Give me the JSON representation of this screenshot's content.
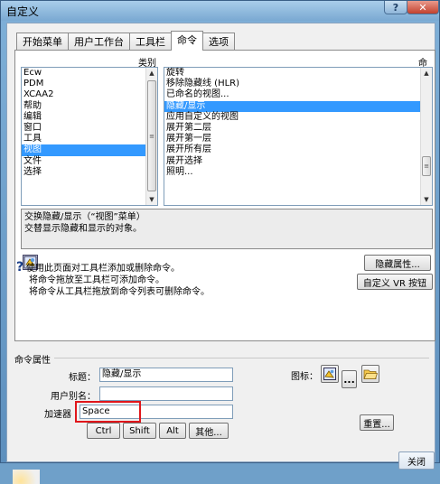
{
  "window": {
    "title": "自定义",
    "help_glyph": "?",
    "close_glyph": "✕"
  },
  "tabs": [
    {
      "label": "开始菜单"
    },
    {
      "label": "用户工作台"
    },
    {
      "label": "工具栏"
    },
    {
      "label": "命令",
      "active": true
    },
    {
      "label": "选项"
    }
  ],
  "category_header": "类别",
  "command_header": "命令",
  "categories": [
    "Ecw",
    "PDM",
    "XCAA2",
    "帮助",
    "编辑",
    "窗口",
    "工具",
    "视图",
    "文件",
    "选择"
  ],
  "selected_category": "视图",
  "commands": [
    "旋转",
    "移除隐藏线 (HLR)",
    "已命名的视图...",
    "隐藏/显示",
    "应用自定义的视图",
    "展开第二层",
    "展开第一层",
    "展开所有层",
    "展开选择",
    "照明..."
  ],
  "selected_command": "隐藏/显示",
  "description": {
    "line1": "交换隐藏/显示（“视图”菜单）",
    "line2": "交替显示隐藏和显示的对象。"
  },
  "buttons": {
    "hide_properties": "隐藏属性...",
    "custom_vr": "自定义 VR 按钮",
    "ctrl": "Ctrl",
    "shift": "Shift",
    "alt": "Alt",
    "other": "其他...",
    "reset": "重置...",
    "icon_more": "...",
    "close": "关闭"
  },
  "help": {
    "line1": "使用此页面对工具栏添加或删除命令。",
    "line2": "将命令拖放至工具栏可添加命令。",
    "line3": "将命令从工具栏拖放到命令列表可删除命令。"
  },
  "properties": {
    "group_label": "命令属性",
    "title_label": "标题：",
    "title_value": "隐藏/显示",
    "alias_label": "用户别名：",
    "alias_value": "",
    "accelerator_label": "加速器",
    "accelerator_value": "Space",
    "icon_label": "图标："
  },
  "colors": {
    "selection": "#3399ff",
    "highlight_box": "#e0161b",
    "title_bar": "#7aa9d2"
  }
}
